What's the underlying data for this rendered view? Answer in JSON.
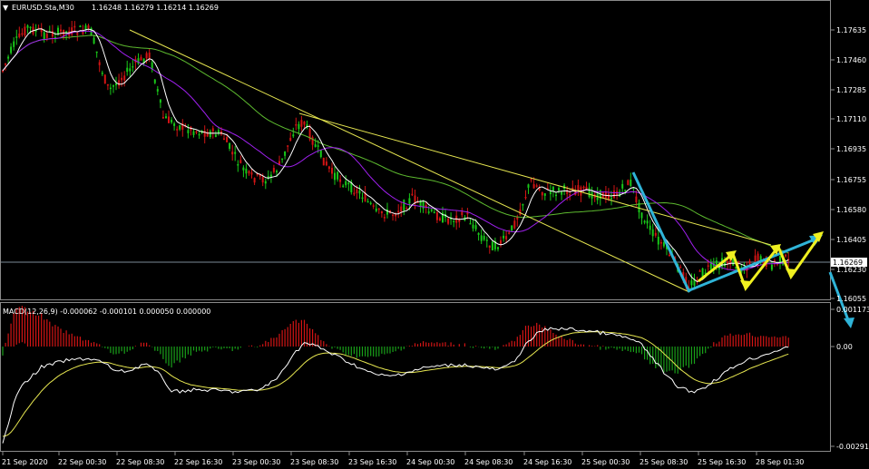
{
  "header": {
    "caret": "▼",
    "symbol_label": "EURUSD.Sta,M30",
    "ohlc": "1.16248 1.16279 1.16214 1.16269"
  },
  "macd": {
    "label": "MACD(12,26,9) -0.000062 -0.000101 0.000050 0.000000",
    "scale": [
      "0.001173",
      "0.00",
      "-0.002914"
    ]
  },
  "price_axis": {
    "ticks": [
      "1.17635",
      "1.17460",
      "1.17285",
      "1.17110",
      "1.16935",
      "1.16755",
      "1.16580",
      "1.16405",
      "1.16230",
      "1.16055"
    ],
    "current_price": "1.16269"
  },
  "time_axis": {
    "labels": [
      "21 Sep 2020",
      "22 Sep 00:30",
      "22 Sep 08:30",
      "22 Sep 16:30",
      "23 Sep 00:30",
      "23 Sep 08:30",
      "23 Sep 16:30",
      "24 Sep 00:30",
      "24 Sep 08:30",
      "24 Sep 16:30",
      "25 Sep 00:30",
      "25 Sep 08:30",
      "25 Sep 16:30",
      "28 Sep 01:30"
    ]
  },
  "colors": {
    "bull_candle": "#19c819",
    "bear_candle": "#d21414",
    "ma_fast": "#ffffff",
    "ma_mid": "#a020f0",
    "ma_slow": "#5dba2f",
    "trendline": "#e6e650",
    "wave_cyan": "#2fb4d8",
    "wave_yellow": "#f0f020",
    "macd_line": "#ffffff",
    "signal_line": "#e6e650",
    "hist_pos": "#d21414",
    "hist_neg": "#19a019",
    "grid_frame": "#8a8a8a"
  },
  "icons": [
    "dropdown-caret-icon"
  ]
}
